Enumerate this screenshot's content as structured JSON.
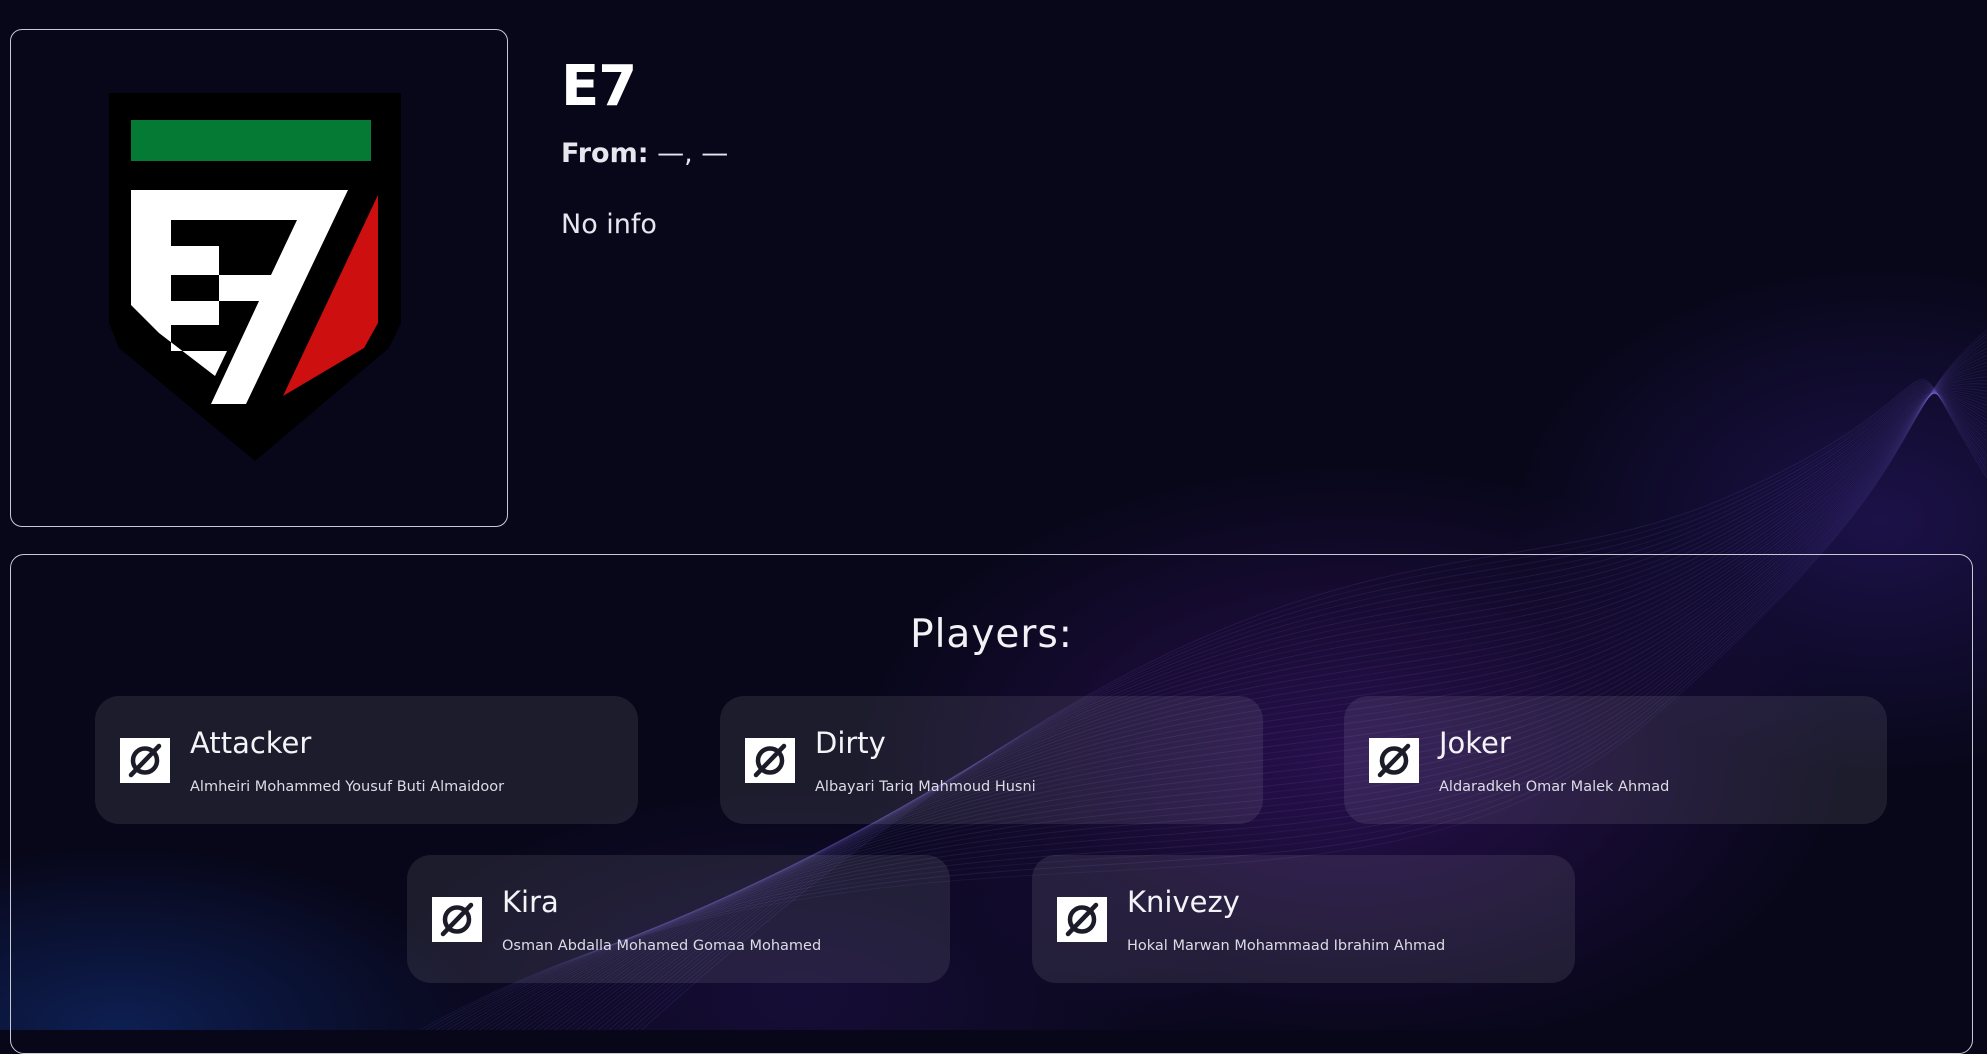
{
  "team": {
    "name": "E7",
    "from_label": "From:",
    "from_value": "—, —",
    "description": "No info",
    "logo_letters": "E7",
    "colors": {
      "green": "#047a35",
      "red": "#cd0f0f",
      "white": "#ffffff",
      "black": "#000000"
    }
  },
  "players_section": {
    "title": "Players:",
    "players": [
      {
        "nickname": "Attacker",
        "full_name": "Almheiri Mohammed Yousuf Buti Almaidoor",
        "icon": "no-photo-icon"
      },
      {
        "nickname": "Dirty",
        "full_name": "Albayari Tariq Mahmoud Husni",
        "icon": "no-photo-icon"
      },
      {
        "nickname": "Joker",
        "full_name": "Aldaradkeh Omar Malek Ahmad",
        "icon": "no-photo-icon"
      },
      {
        "nickname": "Kira",
        "full_name": "Osman Abdalla Mohamed Gomaa Mohamed",
        "icon": "no-photo-icon"
      },
      {
        "nickname": "Knivezy",
        "full_name": "Hokal Marwan Mohammaad Ibrahim Ahmad",
        "icon": "no-photo-icon"
      }
    ]
  },
  "theme": {
    "background": "#08071a",
    "card_border": "#c9c9d6",
    "accent_purple": "#5c1ea0"
  }
}
